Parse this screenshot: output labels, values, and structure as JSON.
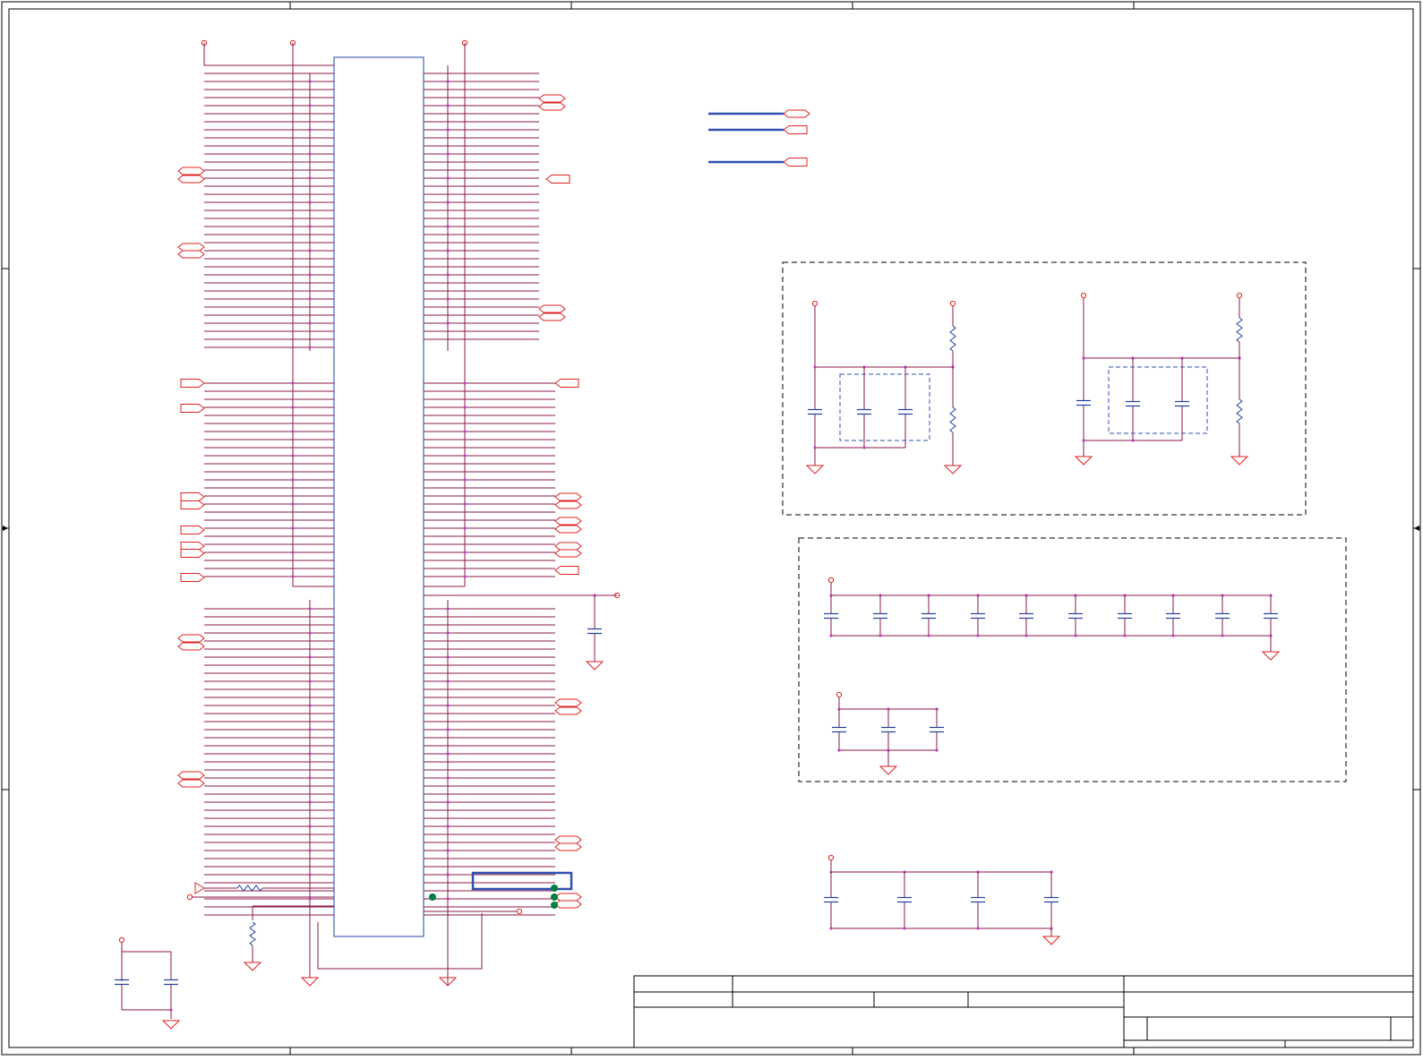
{
  "sheet": {
    "colors": {
      "wire": "#8b1a4a",
      "symbol": "#e02020",
      "part": "#2040a0",
      "junction": "#c040c0",
      "bus": "#3050b0",
      "frame": "#000000",
      "probe": "#008040"
    },
    "blank_title_block": true
  },
  "symbols": {
    "ground": "ground-arrow-symbol",
    "power": "power-circle-symbol",
    "offpage_in": "offpage-connector-in",
    "offpage_bidir": "offpage-connector-bidir",
    "capacitor": "capacitor-symbol",
    "resistor": "resistor-symbol"
  }
}
